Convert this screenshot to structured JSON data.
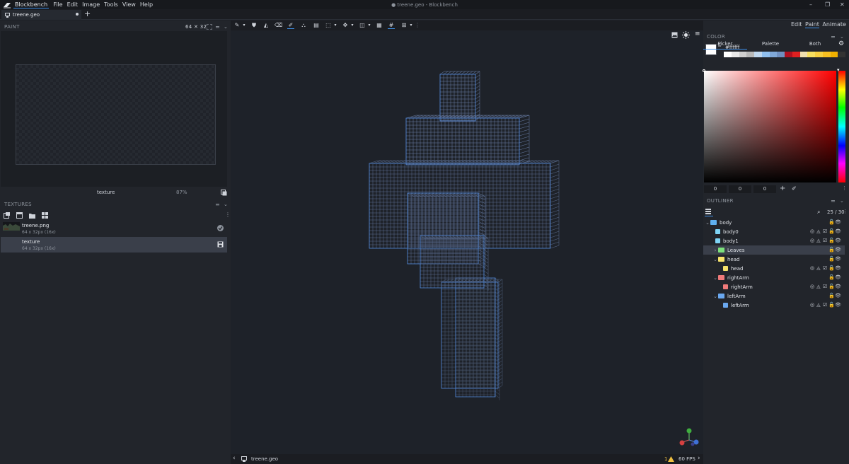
{
  "app": {
    "name": "Blockbench",
    "menu": [
      "File",
      "Edit",
      "Image",
      "Tools",
      "View",
      "Help"
    ],
    "window_title": "● treene.geo - Blockbench",
    "window_buttons": [
      "–",
      "❐",
      "✕"
    ]
  },
  "tabs": {
    "file_tab": "treene.geo",
    "add": "+"
  },
  "paint_panel": {
    "title": "PAINT",
    "resolution": "64 ✕ 32",
    "texture_name": "texture",
    "zoom": "87%"
  },
  "textures_panel": {
    "title": "TEXTURES",
    "items": [
      {
        "name": "treene.png",
        "size": "64 x 32px (16x)"
      },
      {
        "name": "texture",
        "size": "64 x 32px (16x)"
      }
    ]
  },
  "modes": {
    "edit": "Edit",
    "paint": "Paint",
    "animate": "Animate",
    "active": "Paint"
  },
  "color_panel": {
    "title": "COLOR",
    "hex": "#ffffff",
    "tabs": [
      "Picker",
      "Palette",
      "Both"
    ],
    "active_tab": "Picker",
    "rgb": [
      "0",
      "0",
      "0"
    ],
    "palette_colors": [
      "#ffffff",
      "#e8e8e8",
      "#d0d0d0",
      "#b8b8b8",
      "#c0d8f0",
      "#90c0f0",
      "#80a8d8",
      "#7090c0",
      "#b01020",
      "#e02020",
      "#f0e0b0",
      "#f8e060",
      "#f8d040",
      "#f8c020",
      "#f0b000",
      "#333333"
    ]
  },
  "outliner": {
    "title": "OUTLINER",
    "count": "25 / 30",
    "rows": [
      {
        "label": "body",
        "kind": "group",
        "indent": 0,
        "open": true,
        "color": "#5fb0f0"
      },
      {
        "label": "body0",
        "kind": "cube",
        "indent": 1,
        "color": "#7fd4f5"
      },
      {
        "label": "body1",
        "kind": "cube",
        "indent": 1,
        "color": "#7fd4f5"
      },
      {
        "label": "Leaves",
        "kind": "group",
        "indent": 1,
        "open": false,
        "color": "#7ce07c",
        "selected": true
      },
      {
        "label": "head",
        "kind": "group",
        "indent": 1,
        "open": true,
        "color": "#f6e26a"
      },
      {
        "label": "head",
        "kind": "cube",
        "indent": 2,
        "color": "#f6e26a"
      },
      {
        "label": "rightArm",
        "kind": "group",
        "indent": 1,
        "open": true,
        "color": "#f07a7a"
      },
      {
        "label": "rightArm",
        "kind": "cube",
        "indent": 2,
        "color": "#f07a7a"
      },
      {
        "label": "leftArm",
        "kind": "group",
        "indent": 1,
        "open": true,
        "color": "#6aa8f0"
      },
      {
        "label": "leftArm",
        "kind": "cube",
        "indent": 2,
        "color": "#6aa8f0"
      }
    ]
  },
  "status": {
    "file": "treene.geo",
    "warnings": "1",
    "fps": "60 FPS"
  }
}
